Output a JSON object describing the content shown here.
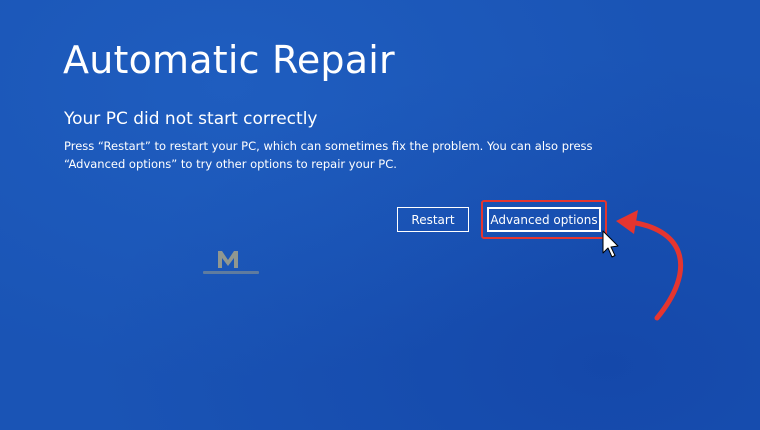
{
  "screen": {
    "title": "Automatic Repair",
    "subtitle": "Your PC did not start correctly",
    "description": "Press “Restart” to restart your PC, which can sometimes fix the problem. You can also press “Advanced options” to try other options to repair your PC."
  },
  "buttons": {
    "restart_label": "Restart",
    "advanced_label": "Advanced options"
  },
  "colors": {
    "background": "#1a54b5",
    "text": "#ffffff",
    "annotation": "#e5352f",
    "watermark": "#b7ad84"
  },
  "icons": {
    "cursor": "mouse-pointer-icon",
    "arrow": "curved-arrow-icon",
    "logo": "watermark-logo-icon"
  }
}
